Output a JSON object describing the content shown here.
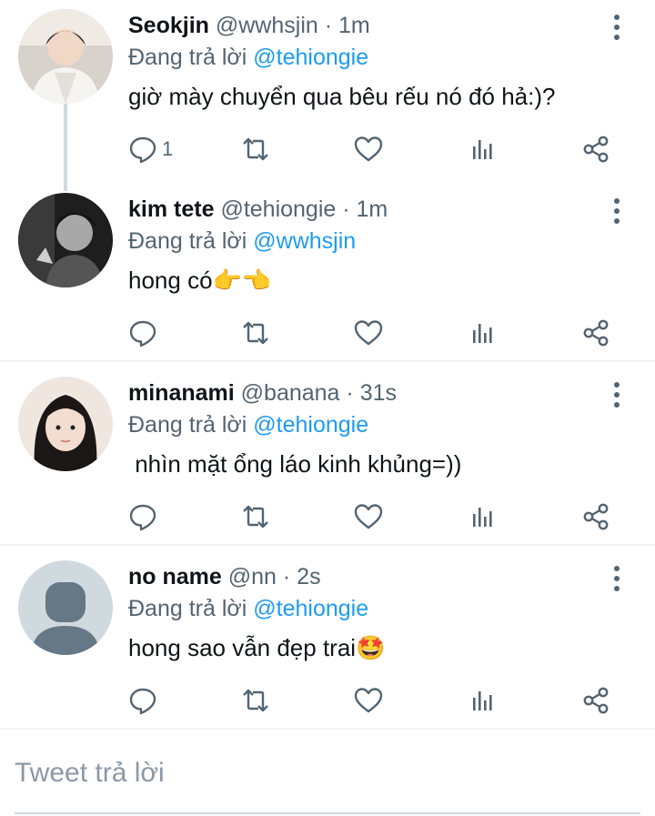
{
  "replies": [
    {
      "name": "Seokjin",
      "handle": "@wwhsjin",
      "time": "1m",
      "reply_prefix": "Đang trả lời ",
      "reply_to": "@tehiongie",
      "text": "giờ mày chuyển qua bêu rếu nó đó hả:)?",
      "reply_count": "1",
      "avatar_colors": [
        "#e9e4dc",
        "#3a3540"
      ]
    },
    {
      "name": "kim tete",
      "handle": "@tehiongie",
      "time": "1m",
      "reply_prefix": "Đang trả lời ",
      "reply_to": "@wwhsjin",
      "text": "hong có👉👈",
      "reply_count": "",
      "avatar_colors": [
        "#2a2a2a",
        "#9b9b9b"
      ]
    },
    {
      "name": "minanami",
      "handle": "@banana",
      "time": "31s",
      "reply_prefix": "Đang trả lời ",
      "reply_to": "@tehiongie",
      "text": " nhìn mặt ổng láo kinh khủng=))",
      "reply_count": "",
      "avatar_colors": [
        "#e8d2c6",
        "#1a1414"
      ]
    },
    {
      "name": "no name",
      "handle": "@nn",
      "time": "2s",
      "reply_prefix": "Đang trả lời ",
      "reply_to": "@tehiongie",
      "text": "hong sao vẫn đẹp trai🤩",
      "reply_count": "",
      "avatar_colors": [
        "#cfd9de",
        "#667786"
      ]
    }
  ],
  "dot": "·",
  "compose": {
    "placeholder": "Tweet trả lời"
  },
  "colors": {
    "accent": "#1d9bf0",
    "secondary": "#536471",
    "divider": "#eff3f4"
  }
}
